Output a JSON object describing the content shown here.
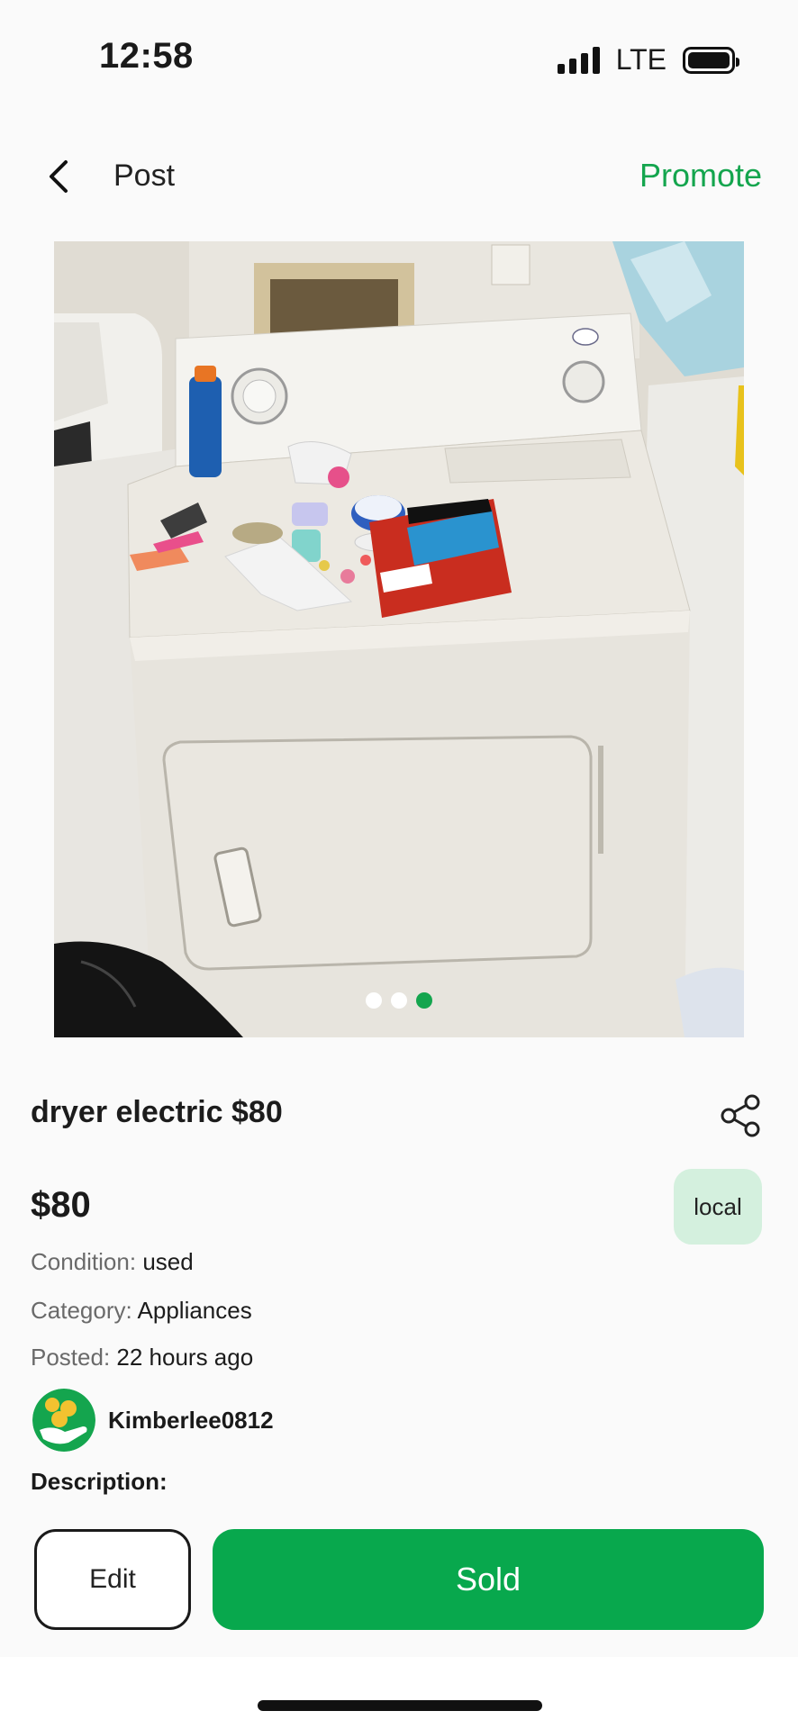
{
  "status_bar": {
    "time": "12:58",
    "network": "LTE"
  },
  "nav": {
    "title": "Post",
    "promote_label": "Promote",
    "back_icon": "chevron-left-icon"
  },
  "photo": {
    "page_count": 3,
    "active_index": 2
  },
  "listing": {
    "title": "dryer electric $80",
    "price": "$80",
    "badge": "local",
    "condition_label": "Condition:",
    "condition_value": "used",
    "category_label": "Category:",
    "category_value": "Appliances",
    "posted_label": "Posted:",
    "posted_value": "22 hours ago"
  },
  "seller": {
    "username": "Kimberlee0812"
  },
  "description": {
    "label": "Description:"
  },
  "actions": {
    "edit_label": "Edit",
    "sold_label": "Sold"
  },
  "colors": {
    "brand_green": "#08a84d",
    "badge_bg": "#d4f0de",
    "promote_green": "#14a54e"
  }
}
